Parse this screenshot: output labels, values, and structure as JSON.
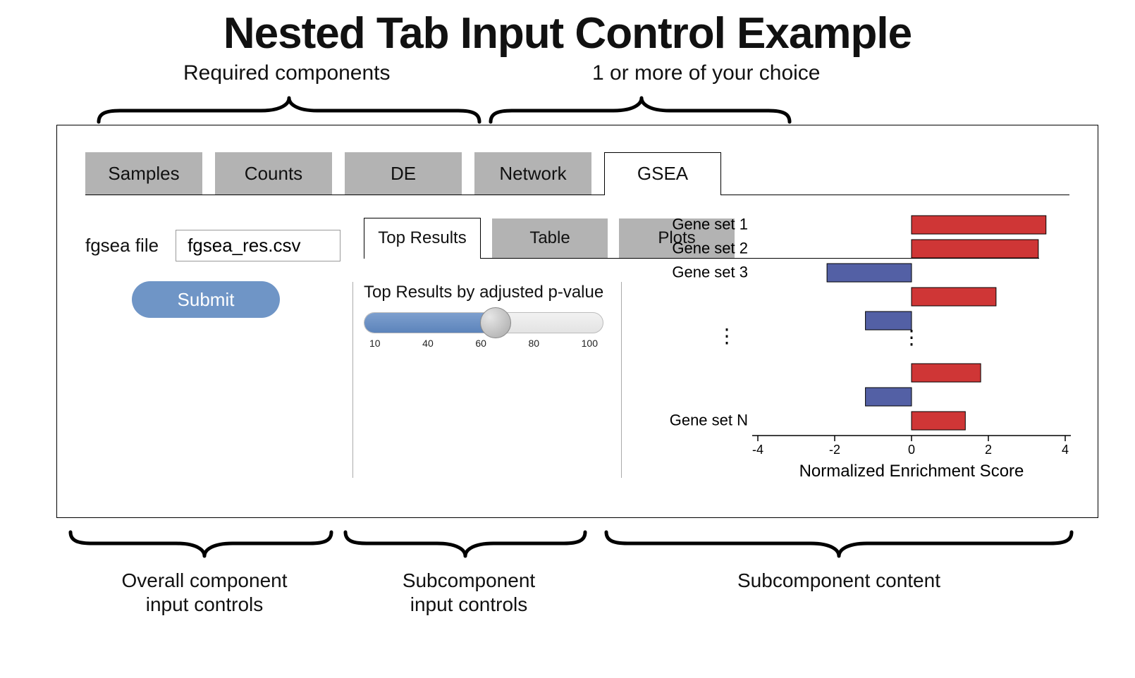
{
  "page": {
    "title": "Nested Tab Input Control Example"
  },
  "annotations": {
    "top_left": "Required components",
    "top_right": "1 or more of your choice",
    "bottom_col1_line1": "Overall component",
    "bottom_col1_line2": "input controls",
    "bottom_col2_line1": "Subcomponent",
    "bottom_col2_line2": "input controls",
    "bottom_col3": "Subcomponent content"
  },
  "tabs": {
    "active_index": 4,
    "items": [
      "Samples",
      "Counts",
      "DE",
      "Network",
      "GSEA"
    ]
  },
  "col1": {
    "file_label": "fgsea file",
    "file_value": "fgsea_res.csv",
    "submit_label": "Submit"
  },
  "subtabs": {
    "active_index": 0,
    "items": [
      "Top Results",
      "Table",
      "Plots"
    ]
  },
  "slider": {
    "title": "Top Results by adjusted p-value",
    "ticks": [
      "10",
      "40",
      "60",
      "80",
      "100"
    ],
    "value_index": 2
  },
  "chart_data": {
    "type": "bar",
    "orientation": "horizontal",
    "title": "",
    "xlabel": "Normalized Enrichment Score",
    "ylabel": "",
    "xlim": [
      -4,
      4
    ],
    "xticks": [
      -4,
      -2,
      0,
      2,
      4
    ],
    "truncated_between": [
      5,
      6
    ],
    "categories": [
      "Gene set 1",
      "Gene set 2",
      "Gene set 3",
      "",
      "",
      "…",
      "",
      "",
      "Gene set N"
    ],
    "values": [
      3.5,
      3.3,
      -2.2,
      2.2,
      -1.2,
      null,
      1.8,
      -1.2,
      1.4
    ],
    "label_visible": [
      true,
      true,
      true,
      false,
      false,
      false,
      false,
      false,
      true
    ],
    "colors": [
      "#cf3636",
      "#cf3636",
      "#5360a5",
      "#cf3636",
      "#5360a5",
      null,
      "#cf3636",
      "#5360a5",
      "#cf3636"
    ]
  }
}
